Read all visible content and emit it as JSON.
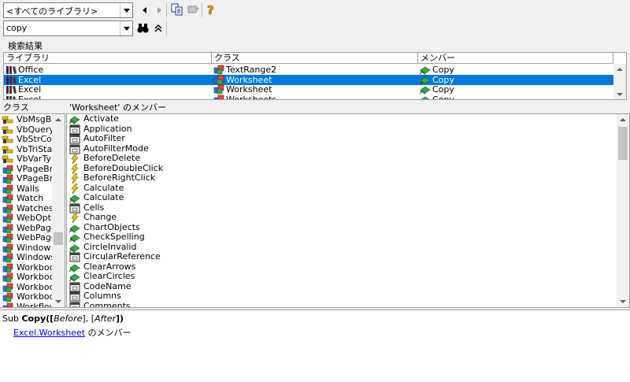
{
  "toolbar": {
    "library_combo_value": "<すべてのライブラリ>",
    "search_combo_value": "copy"
  },
  "search_results": {
    "group_label": "検索結果",
    "columns": [
      "ライブラリ",
      "クラス",
      "メンバー"
    ],
    "rows": [
      {
        "library": "Office",
        "class": "TextRange2",
        "member": "Copy",
        "selected": false
      },
      {
        "library": "Excel",
        "class": "Worksheet",
        "member": "Copy",
        "selected": true
      },
      {
        "library": "Excel",
        "class": "Worksheet",
        "member": "Copy",
        "selected": false
      },
      {
        "library": "Excel",
        "class": "Worksheets",
        "member": "Copy",
        "selected": false
      }
    ]
  },
  "classes": {
    "title": "クラス",
    "items": [
      {
        "label": "VbMsgBox",
        "icon": "enum-icon"
      },
      {
        "label": "VbQueryC",
        "icon": "enum-icon"
      },
      {
        "label": "VbStrCon",
        "icon": "enum-icon"
      },
      {
        "label": "VbTriState",
        "icon": "enum-icon"
      },
      {
        "label": "VbVarTyp",
        "icon": "enum-icon"
      },
      {
        "label": "VPageBre",
        "icon": "class-icon"
      },
      {
        "label": "VPageBre",
        "icon": "class-icon"
      },
      {
        "label": "Walls",
        "icon": "class-icon"
      },
      {
        "label": "Watch",
        "icon": "class-icon"
      },
      {
        "label": "Watches",
        "icon": "class-icon"
      },
      {
        "label": "WebOptio",
        "icon": "class-icon"
      },
      {
        "label": "WebPageI",
        "icon": "class-icon"
      },
      {
        "label": "WebPageI",
        "icon": "class-icon"
      },
      {
        "label": "Window",
        "icon": "class-icon"
      },
      {
        "label": "Windows",
        "icon": "class-icon"
      },
      {
        "label": "Workbook",
        "icon": "class-icon"
      },
      {
        "label": "Workbook",
        "icon": "class-icon"
      },
      {
        "label": "Workbook",
        "icon": "class-icon"
      },
      {
        "label": "Workbook",
        "icon": "class-icon"
      },
      {
        "label": "Workflow",
        "icon": "class-icon"
      }
    ]
  },
  "members": {
    "title": "'Worksheet' のメンバー",
    "items": [
      {
        "label": "Activate",
        "icon": "method-icon"
      },
      {
        "label": "Application",
        "icon": "property-icon"
      },
      {
        "label": "AutoFilter",
        "icon": "property-icon"
      },
      {
        "label": "AutoFilterMode",
        "icon": "property-icon"
      },
      {
        "label": "BeforeDelete",
        "icon": "event-icon"
      },
      {
        "label": "BeforeDoubleClick",
        "icon": "event-icon"
      },
      {
        "label": "BeforeRightClick",
        "icon": "event-icon"
      },
      {
        "label": "Calculate",
        "icon": "event-icon"
      },
      {
        "label": "Calculate",
        "icon": "method-icon"
      },
      {
        "label": "Cells",
        "icon": "property-icon"
      },
      {
        "label": "Change",
        "icon": "event-icon"
      },
      {
        "label": "ChartObjects",
        "icon": "method-icon"
      },
      {
        "label": "CheckSpelling",
        "icon": "method-icon"
      },
      {
        "label": "CircleInvalid",
        "icon": "method-icon"
      },
      {
        "label": "CircularReference",
        "icon": "property-icon"
      },
      {
        "label": "ClearArrows",
        "icon": "method-icon"
      },
      {
        "label": "ClearCircles",
        "icon": "method-icon"
      },
      {
        "label": "CodeName",
        "icon": "property-icon"
      },
      {
        "label": "Columns",
        "icon": "property-icon"
      },
      {
        "label": "Comments",
        "icon": "property-icon"
      }
    ]
  },
  "detail": {
    "sub_keyword": "Sub",
    "name": "Copy",
    "params_open": "([",
    "param1": "Before",
    "params_mid": "], [",
    "param2": "After",
    "params_close": "])",
    "link_library": "Excel",
    "link_dot": ".",
    "link_class": "Worksheet",
    "member_of": " のメンバー"
  },
  "colors": {
    "selection": "#0078d7",
    "link": "#0000ee"
  }
}
